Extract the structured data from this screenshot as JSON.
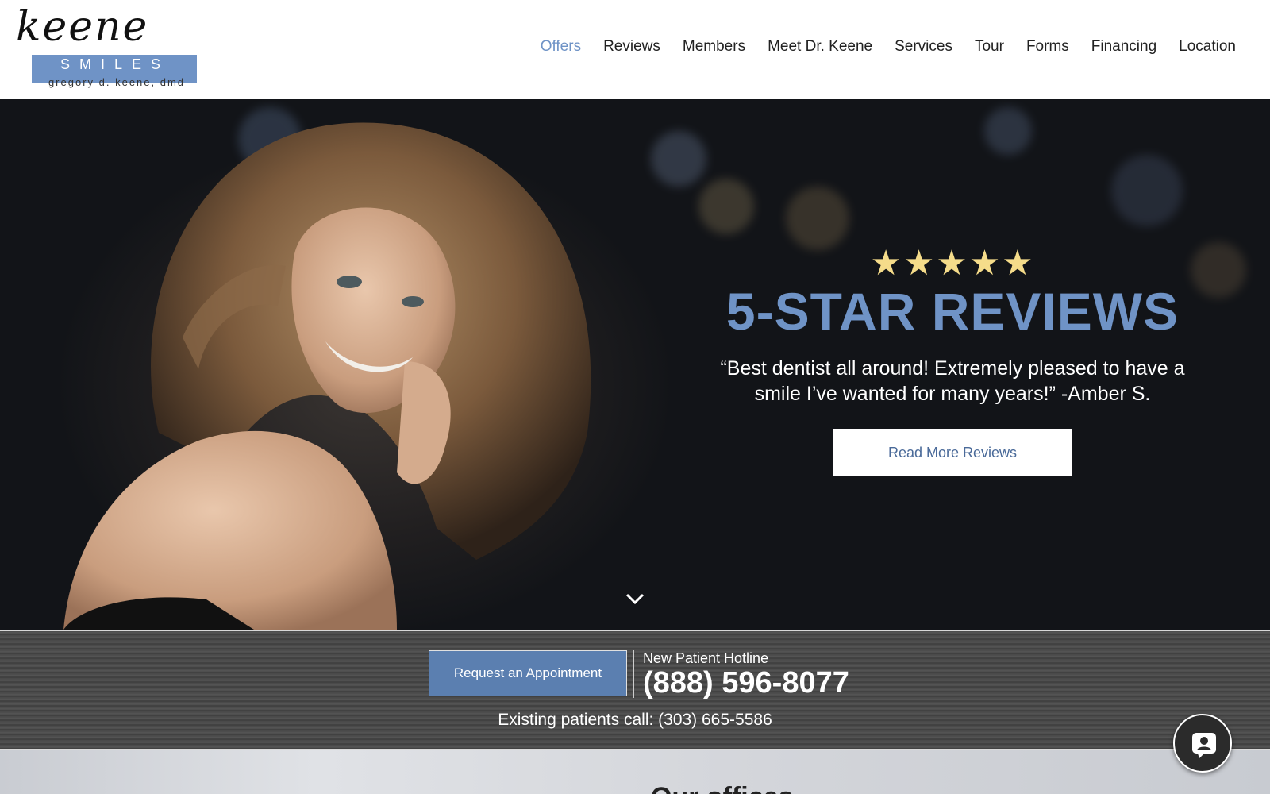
{
  "logo": {
    "script": "keene",
    "word": "SMILES",
    "subtitle": "gregory d. keene, dmd"
  },
  "nav": {
    "items": [
      {
        "label": "Offers",
        "active": true
      },
      {
        "label": "Reviews"
      },
      {
        "label": "Members"
      },
      {
        "label": "Meet Dr. Keene"
      },
      {
        "label": "Services"
      },
      {
        "label": "Tour"
      },
      {
        "label": "Forms"
      },
      {
        "label": "Financing"
      },
      {
        "label": "Location"
      }
    ]
  },
  "hero": {
    "stars": "★★★★★",
    "rating": 5,
    "title": "5-STAR REVIEWS",
    "quote": "“Best dentist all around! Extremely pleased to have a smile I’ve wanted for many years!” -Amber S.",
    "button": "Read More Reviews"
  },
  "contact": {
    "appointment_button": "Request an Appointment",
    "hotline_label": "New Patient Hotline",
    "hotline_number": "(888) 596-8077",
    "existing": "Existing patients call: (303) 665-5586"
  },
  "bottom": {
    "heading": "Our offices..."
  },
  "colors": {
    "brand_blue": "#6f93c6",
    "button_blue": "#5b7fb0",
    "star": "#f5dc8a"
  },
  "icons": {
    "scroll": "chevron-down-icon",
    "chat": "chat-icon"
  }
}
